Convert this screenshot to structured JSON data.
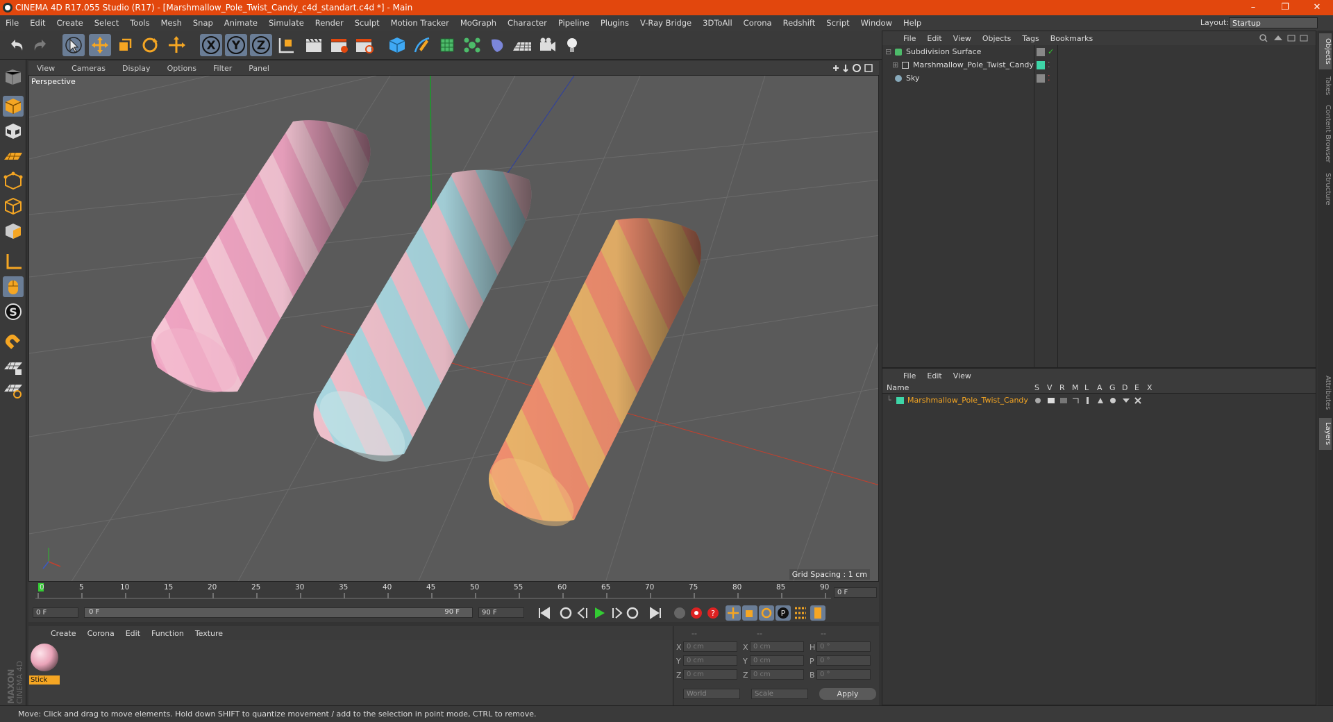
{
  "window": {
    "title": "CINEMA 4D R17.055 Studio (R17) - [Marshmallow_Pole_Twist_Candy_c4d_standart.c4d *] - Main",
    "min": "–",
    "max": "❐",
    "close": "✕"
  },
  "menu": [
    "File",
    "Edit",
    "Create",
    "Select",
    "Tools",
    "Mesh",
    "Snap",
    "Animate",
    "Simulate",
    "Render",
    "Sculpt",
    "Motion Tracker",
    "MoGraph",
    "Character",
    "Pipeline",
    "Plugins",
    "V-Ray Bridge",
    "3DToAll",
    "Corona",
    "Redshift",
    "Script",
    "Window",
    "Help"
  ],
  "layout": {
    "label": "Layout:",
    "value": "Startup"
  },
  "toolbar": {
    "x": "X",
    "y": "Y",
    "z": "Z"
  },
  "viewport": {
    "menu": [
      "View",
      "Cameras",
      "Display",
      "Options",
      "Filter",
      "Panel"
    ],
    "label": "Perspective",
    "grid_spacing": "Grid Spacing : 1 cm"
  },
  "timeline": {
    "ticks": [
      "0",
      "5",
      "10",
      "15",
      "20",
      "25",
      "30",
      "35",
      "40",
      "45",
      "50",
      "55",
      "60",
      "65",
      "70",
      "75",
      "80",
      "85",
      "90"
    ],
    "current": "0 F",
    "start": "0 F",
    "slider_start": "0 F",
    "slider_end": "90 F",
    "end": "90 F"
  },
  "materials": {
    "menu": [
      "Create",
      "Corona",
      "Edit",
      "Function",
      "Texture"
    ],
    "items": [
      {
        "name": "Stick"
      }
    ]
  },
  "coords": {
    "headers": [
      "--",
      "--",
      "--"
    ],
    "rows": [
      {
        "a": "X",
        "v1": "0 cm",
        "b": "X",
        "v2": "0 cm",
        "c": "H",
        "v3": "0 °"
      },
      {
        "a": "Y",
        "v1": "0 cm",
        "b": "Y",
        "v2": "0 cm",
        "c": "P",
        "v3": "0 °"
      },
      {
        "a": "Z",
        "v1": "0 cm",
        "b": "Z",
        "v2": "0 cm",
        "c": "B",
        "v3": "0 °"
      }
    ],
    "world": "World",
    "scale": "Scale",
    "apply": "Apply"
  },
  "objects": {
    "menu": [
      "File",
      "Edit",
      "View",
      "Objects",
      "Tags",
      "Bookmarks"
    ],
    "items": [
      {
        "name": "Subdivision Surface"
      },
      {
        "name": "Marshmallow_Pole_Twist_Candy"
      },
      {
        "name": "Sky"
      }
    ]
  },
  "layers": {
    "menu": [
      "File",
      "Edit",
      "View"
    ],
    "columns": [
      "Name",
      "S",
      "V",
      "R",
      "M",
      "L",
      "A",
      "G",
      "D",
      "E",
      "X"
    ],
    "items": [
      {
        "name": "Marshmallow_Pole_Twist_Candy"
      }
    ]
  },
  "right_tabs": [
    "Objects",
    "Takes",
    "Content Browser",
    "Structure",
    "Attributes",
    "Layers"
  ],
  "brand": {
    "maxon": "MAXON",
    "c4d": "CINEMA 4D"
  },
  "status": "Move: Click and drag to move elements. Hold down SHIFT to quantize movement / add to the selection in point mode, CTRL to remove."
}
